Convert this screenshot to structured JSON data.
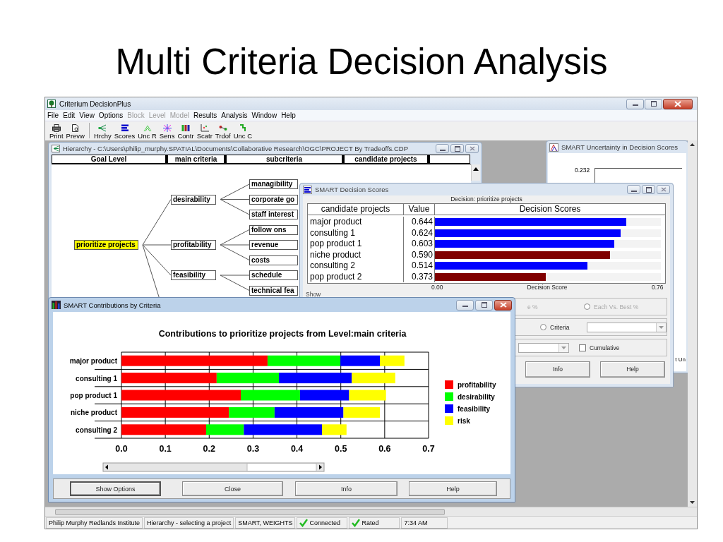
{
  "slide_title": "Multi Criteria Decision Analysis",
  "app": {
    "title": "Criterium DecisionPlus",
    "menu": [
      {
        "label": "File",
        "disabled": false
      },
      {
        "label": "Edit",
        "disabled": false
      },
      {
        "label": "View",
        "disabled": false
      },
      {
        "label": "Options",
        "disabled": false
      },
      {
        "label": "Block",
        "disabled": true
      },
      {
        "label": "Level",
        "disabled": true
      },
      {
        "label": "Model",
        "disabled": true
      },
      {
        "label": "Results",
        "disabled": false
      },
      {
        "label": "Analysis",
        "disabled": false
      },
      {
        "label": "Window",
        "disabled": false
      },
      {
        "label": "Help",
        "disabled": false
      }
    ],
    "toolbar": [
      {
        "label": "Print",
        "kind": "print"
      },
      {
        "label": "Prevw",
        "kind": "preview"
      },
      {
        "label": "Hrchy",
        "kind": "hierarchy"
      },
      {
        "label": "Scores",
        "kind": "scores"
      },
      {
        "label": "Unc R",
        "kind": "uncr"
      },
      {
        "label": "Sens",
        "kind": "sens"
      },
      {
        "label": "Contr",
        "kind": "contr"
      },
      {
        "label": "Scatr",
        "kind": "scatr"
      },
      {
        "label": "Trdof",
        "kind": "trdof"
      },
      {
        "label": "Unc C",
        "kind": "uncc"
      }
    ]
  },
  "hierarchy_window": {
    "title": "Hierarchy - C:\\Users\\philip_murphy.SPATIAL\\Documents\\Collaborative Research\\OGC\\PROJECT By Tradeoffs.CDP",
    "columns": [
      "Goal Level",
      "main criteria",
      "subcriteria",
      "candidate projects"
    ],
    "tree": {
      "label": "prioritize projects",
      "selected": true,
      "children": [
        {
          "label": "desirability",
          "selected": false,
          "children": [
            {
              "label": "managibility",
              "selected": false
            },
            {
              "label": "corporate go",
              "selected": false
            },
            {
              "label": "staff interest",
              "selected": false
            }
          ]
        },
        {
          "label": "profitability",
          "selected": false,
          "children": [
            {
              "label": "follow ons",
              "selected": false
            },
            {
              "label": "revenue",
              "selected": false
            },
            {
              "label": "costs",
              "selected": false
            }
          ]
        },
        {
          "label": "feasibility",
          "selected": false,
          "children": [
            {
              "label": "schedule",
              "selected": false
            },
            {
              "label": "technical fea",
              "selected": false
            }
          ]
        }
      ]
    }
  },
  "uncertainty_window": {
    "title": "SMART Uncertainty in Decision Scores",
    "tick_label": "0.232",
    "button_fragment": "t Un"
  },
  "decision_window": {
    "title": "SMART  Decision Scores",
    "subtitle": "Decision: prioritize projects",
    "columns": [
      "candidate projects",
      "Value",
      "Decision Scores"
    ],
    "rows": [
      {
        "name": "major product",
        "value": "0.644",
        "level": 0.847,
        "color": "#0000ff"
      },
      {
        "name": "consulting 1",
        "value": "0.624",
        "level": 0.821,
        "color": "#0000ff"
      },
      {
        "name": "pop product 1",
        "value": "0.603",
        "level": 0.793,
        "color": "#0000ff"
      },
      {
        "name": "niche product",
        "value": "0.590",
        "level": 0.776,
        "color": "#800000"
      },
      {
        "name": "consulting 2",
        "value": "0.514",
        "level": 0.676,
        "color": "#0000ff"
      },
      {
        "name": "pop product 2",
        "value": "0.373",
        "level": 0.491,
        "color": "#800000"
      }
    ],
    "axis": {
      "min": "0.00",
      "label": "Decision Score",
      "max": "0.76"
    },
    "group_label": "Show",
    "fragment": "e %",
    "options": [
      {
        "label": "Each Vs. Best %",
        "disabled": true,
        "selected": false
      },
      {
        "label": "Criteria",
        "disabled": false,
        "selected": false
      }
    ],
    "cumulative": {
      "label": "Cumulative",
      "checked": false
    },
    "buttons": [
      "Info",
      "Help"
    ]
  },
  "contributions_window": {
    "title": "SMART Contributions by Criteria",
    "chart_data": {
      "type": "bar",
      "orientation": "horizontal",
      "stacked": true,
      "title": "Contributions to prioritize projects from Level:main criteria",
      "categories": [
        "major product",
        "consulting 1",
        "pop product 1",
        "niche product",
        "consulting 2"
      ],
      "series": [
        {
          "name": "profitability",
          "color": "#ff0000",
          "values": [
            0.333,
            0.217,
            0.272,
            0.245,
            0.193
          ]
        },
        {
          "name": "desirability",
          "color": "#00ff00",
          "values": [
            0.166,
            0.142,
            0.135,
            0.104,
            0.086
          ]
        },
        {
          "name": "feasibility",
          "color": "#0000ff",
          "values": [
            0.09,
            0.166,
            0.112,
            0.157,
            0.178
          ]
        },
        {
          "name": "risk",
          "color": "#ffff00",
          "values": [
            0.056,
            0.099,
            0.084,
            0.083,
            0.056
          ]
        }
      ],
      "xlim": [
        0,
        0.7
      ],
      "grid": true,
      "legend": true,
      "xticks": [
        {
          "value": 0,
          "label": "0.0"
        },
        {
          "value": 0.1,
          "label": "0.1"
        },
        {
          "value": 0.2,
          "label": "0.2"
        },
        {
          "value": 0.3,
          "label": "0.3"
        },
        {
          "value": 0.4,
          "label": "0.4"
        },
        {
          "value": 0.5,
          "label": "0.5"
        },
        {
          "value": 0.6,
          "label": "0.6"
        },
        {
          "value": 0.7,
          "label": "0.7"
        }
      ]
    },
    "buttons": [
      "Show Options",
      "Close",
      "Info",
      "Help"
    ]
  },
  "status_bar": [
    {
      "text": "Philip Murphy Redlands Institute",
      "checked": false
    },
    {
      "text": "Hierarchy - selecting a project",
      "checked": false
    },
    {
      "text": "SMART, WEIGHTS",
      "checked": false
    },
    {
      "text": "Connected",
      "checked": true
    },
    {
      "text": "Rated",
      "checked": true
    },
    {
      "text": "7:34 AM",
      "checked": false
    }
  ]
}
